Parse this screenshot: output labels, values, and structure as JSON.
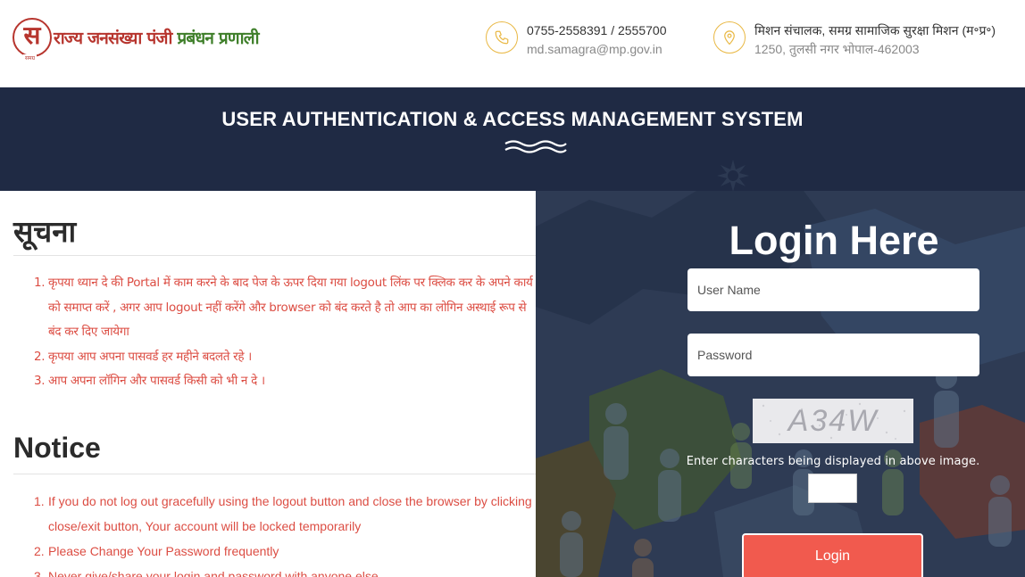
{
  "header": {
    "logo": {
      "mark_glyph": "स",
      "mark_subtext": "समग्र",
      "title_part1": "राज्य जनसंख्या पंजी ",
      "title_part2": "प्रबंधन प्रणाली"
    },
    "phone": "0755-2558391 / 2555700",
    "email": "md.samagra@mp.gov.in",
    "address_line1": "मिशन संचालक, समग्र सामाजिक सुरक्षा मिशन (म॰प्र॰)",
    "address_line2": "1250, तुलसी नगर भोपाल-462003",
    "icons": {
      "phone": "phone-icon",
      "location": "location-pin-icon"
    },
    "accent_color": "#e9b844"
  },
  "banner": {
    "title": "USER AUTHENTICATION & ACCESS MANAGEMENT SYSTEM",
    "background": "#1f2a44"
  },
  "notice_hindi": {
    "heading": "सूचना",
    "items": [
      {
        "num": "1.",
        "text": "कृपया ध्यान दे की Portal में काम करने के बाद पेज के ऊपर दिया गया logout लिंक पर क्लिक कर के अपने कार्य को समाप्त करें , अगर आप logout नहीं करेंगे और browser को बंद करते है तो आप का लोगिन अस्थाई रूप से बंद कर दिए जायेगा"
      },
      {
        "num": "2.",
        "text": "कृपया आप अपना पासवर्ड हर महीने बदलते रहे ।"
      },
      {
        "num": "3.",
        "text": "आप अपना लॉगिन और पासवर्ड किसी को भी न दे ।"
      }
    ]
  },
  "notice_english": {
    "heading": "Notice",
    "items": [
      {
        "num": "1.",
        "text": "If you do not log out gracefully using the logout button and close the browser by clicking close/exit button, Your account will be locked temporarily"
      },
      {
        "num": "2.",
        "text": "Please Change Your Password frequently"
      },
      {
        "num": "3.",
        "text": "Never give/share your login and password with anyone else"
      }
    ]
  },
  "login": {
    "title": "Login Here",
    "username_placeholder": "User Name",
    "password_placeholder": "Password",
    "captcha_text": "A34W",
    "captcha_hint": "Enter characters being displayed in above image.",
    "button_label": "Login",
    "button_color": "#f15a4e"
  },
  "colors": {
    "notice_text": "#dc4d43",
    "login_panel": "#2e3b54"
  }
}
